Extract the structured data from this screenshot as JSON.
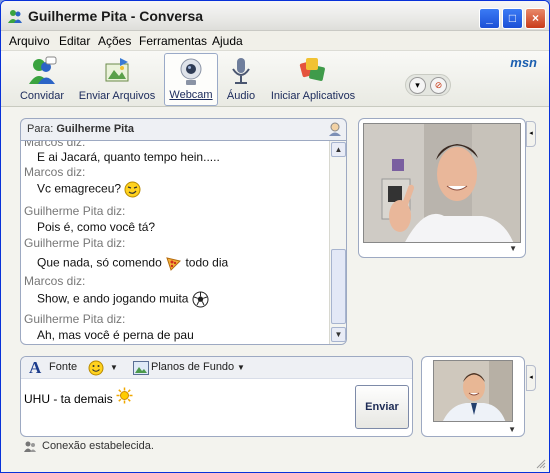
{
  "window": {
    "title": "Guilherme Pita - Conversa",
    "buttons": [
      "minimize",
      "maximize",
      "close"
    ]
  },
  "menu": [
    "Arquivo",
    "Editar",
    "Ações",
    "Ferramentas",
    "Ajuda"
  ],
  "toolbar": {
    "items": [
      {
        "label": "Convidar",
        "icon": "invite-icon"
      },
      {
        "label": "Enviar Arquivos",
        "icon": "send-files-icon"
      },
      {
        "label": "Webcam",
        "icon": "webcam-icon"
      },
      {
        "label": "Áudio",
        "icon": "microphone-icon"
      },
      {
        "label": "Iniciar Aplicativos",
        "icon": "applications-icon"
      }
    ],
    "active": "Webcam",
    "brand": "msn"
  },
  "conversation": {
    "to_label": "Para:",
    "to_name": "Guilherme Pita",
    "lines": [
      {
        "type": "sender",
        "text": "Marcos diz:"
      },
      {
        "type": "message",
        "text": "E ai Jacará, quanto tempo hein....."
      },
      {
        "type": "sender",
        "text": "Marcos diz:"
      },
      {
        "type": "message",
        "text": "Vc emagreceu?",
        "emoticon": "smirk-icon"
      },
      {
        "type": "sender",
        "text": "Guilherme Pita diz:"
      },
      {
        "type": "message",
        "text": "Pois é, como você tá?"
      },
      {
        "type": "sender",
        "text": "Guilherme Pita diz:"
      },
      {
        "type": "message",
        "text": "Que nada, só comendo",
        "emoticon": "pizza-icon",
        "text_after": "todo dia"
      },
      {
        "type": "sender",
        "text": "Marcos diz:"
      },
      {
        "type": "message",
        "text": "Show, e ando jogando muita",
        "emoticon": "soccer-ball-icon"
      },
      {
        "type": "sender",
        "text": "Guilherme Pita diz:"
      },
      {
        "type": "message",
        "text": "Ah, mas você é perna de pau"
      }
    ]
  },
  "compose": {
    "font_label": "Fonte",
    "background_label": "Planos de Fundo",
    "typed_text": "UHU - ta demais",
    "typed_emoticon": "sun-icon",
    "send_label": "Enviar"
  },
  "status": {
    "text": "Conexão estabelecida."
  },
  "colors": {
    "title_bar": "#0831d9",
    "panel_border": "#9da9c2",
    "sender_gray": "#777777",
    "toolbar_label": "#1b2a5b"
  }
}
